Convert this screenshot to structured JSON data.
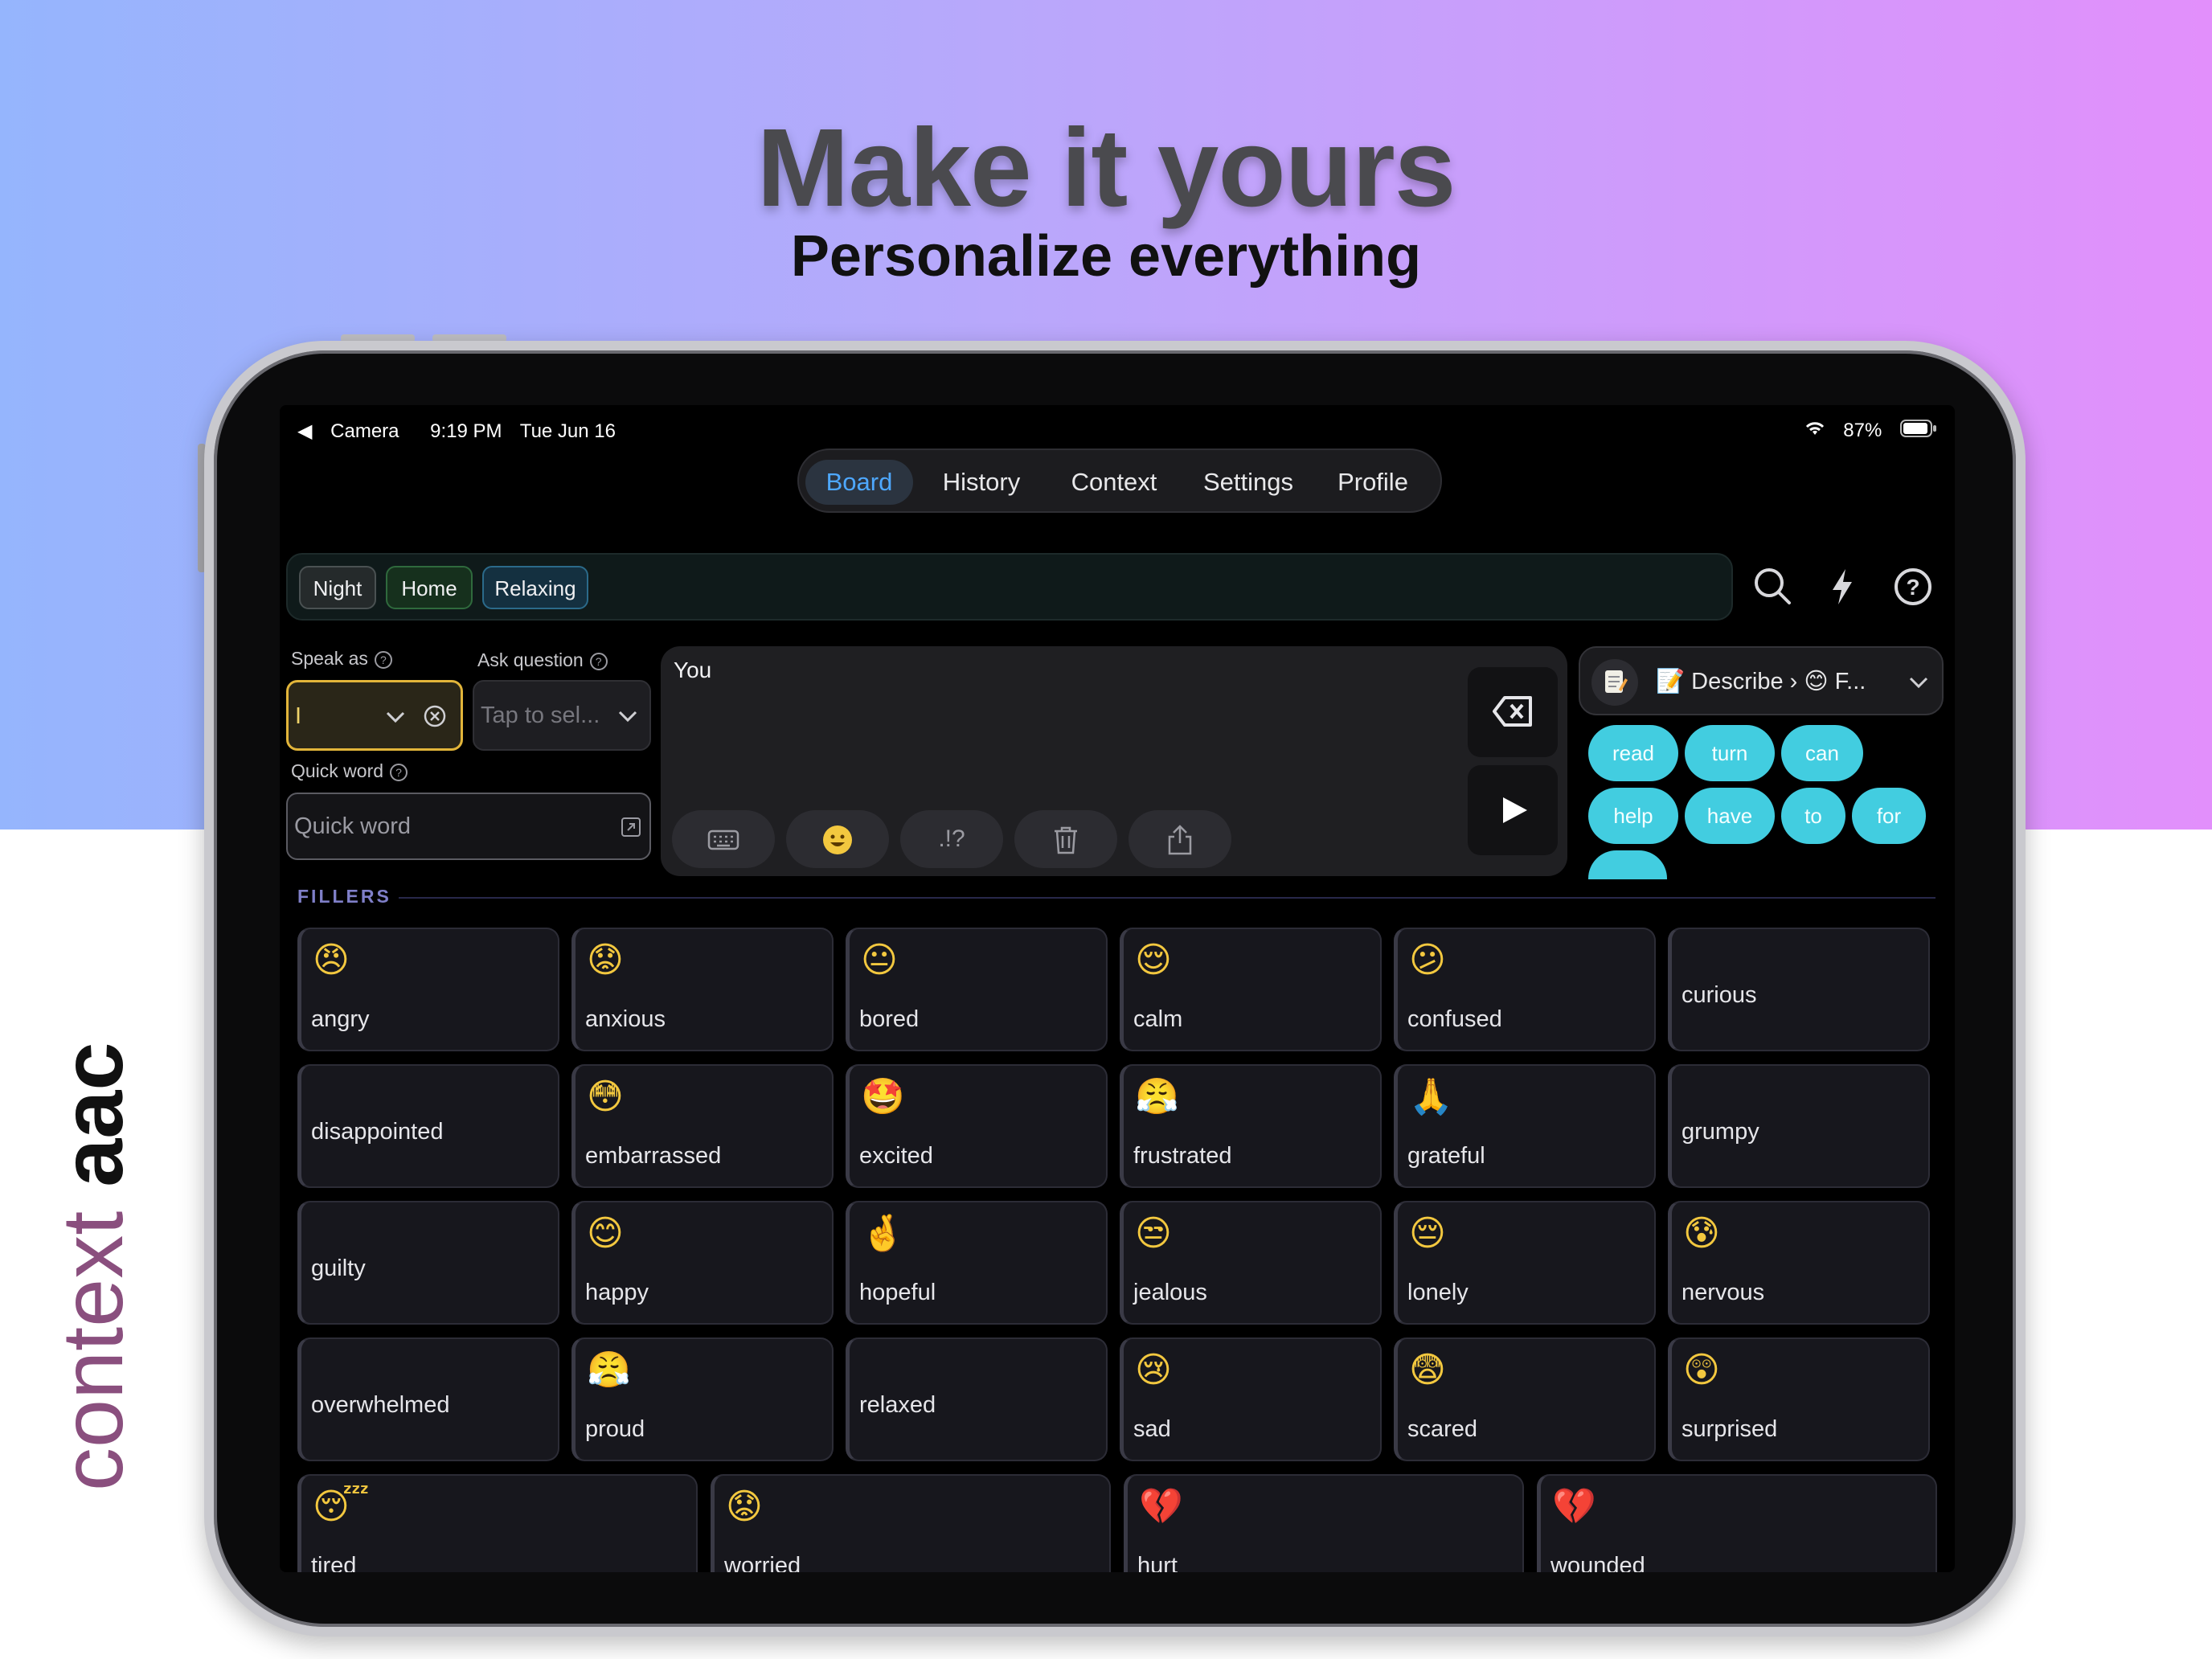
{
  "headline": "Make it yours",
  "subheadline": "Personalize everything",
  "brand": {
    "part1": "context",
    "part2": "aac"
  },
  "status_bar": {
    "back": "Camera",
    "time": "9:19 PM",
    "date": "Tue Jun 16",
    "battery": "87%"
  },
  "nav_tabs": [
    "Board",
    "History",
    "Context",
    "Settings",
    "Profile"
  ],
  "active_tab": "Board",
  "context_chips": [
    "Night",
    "Home",
    "Relaxing"
  ],
  "speak_as": {
    "label": "Speak as",
    "value": "I"
  },
  "ask_question": {
    "label": "Ask question",
    "placeholder": "Tap to sel..."
  },
  "quick_word": {
    "label": "Quick word",
    "placeholder": "Quick word"
  },
  "compose": {
    "text": "You"
  },
  "describe_dropdown": {
    "value": "📝 Describe › 😊 F..."
  },
  "suggestions": [
    "read",
    "turn",
    "can",
    "help",
    "have",
    "to",
    "for"
  ],
  "section_label": "FILLERS",
  "tiles": [
    {
      "word": "angry",
      "emoji": "😠"
    },
    {
      "word": "anxious",
      "emoji": "😟"
    },
    {
      "word": "bored",
      "emoji": "😐"
    },
    {
      "word": "calm",
      "emoji": "😌"
    },
    {
      "word": "confused",
      "emoji": "😕"
    },
    {
      "word": "curious",
      "emoji": ""
    },
    {
      "word": "disappointed",
      "emoji": ""
    },
    {
      "word": "embarrassed",
      "emoji": "😳"
    },
    {
      "word": "excited",
      "emoji": "🤩"
    },
    {
      "word": "frustrated",
      "emoji": "😤"
    },
    {
      "word": "grateful",
      "emoji": "🙏"
    },
    {
      "word": "grumpy",
      "emoji": ""
    },
    {
      "word": "guilty",
      "emoji": ""
    },
    {
      "word": "happy",
      "emoji": "😊"
    },
    {
      "word": "hopeful",
      "emoji": "🤞"
    },
    {
      "word": "jealous",
      "emoji": "😒"
    },
    {
      "word": "lonely",
      "emoji": "😔"
    },
    {
      "word": "nervous",
      "emoji": "😰"
    },
    {
      "word": "overwhelmed",
      "emoji": ""
    },
    {
      "word": "proud",
      "emoji": "😤"
    },
    {
      "word": "relaxed",
      "emoji": ""
    },
    {
      "word": "sad",
      "emoji": "😢"
    },
    {
      "word": "scared",
      "emoji": "😨"
    },
    {
      "word": "surprised",
      "emoji": "😲"
    },
    {
      "word": "tired",
      "emoji": "😴"
    },
    {
      "word": "worried",
      "emoji": "😟"
    },
    {
      "word": "hurt",
      "emoji": "💔"
    },
    {
      "word": "wounded",
      "emoji": "💔"
    }
  ],
  "colors": {
    "accent": "#4ea8ff",
    "suggestion": "#42cde0",
    "speak_as_border": "#e2b53a",
    "section_label": "#7f7fc8"
  }
}
